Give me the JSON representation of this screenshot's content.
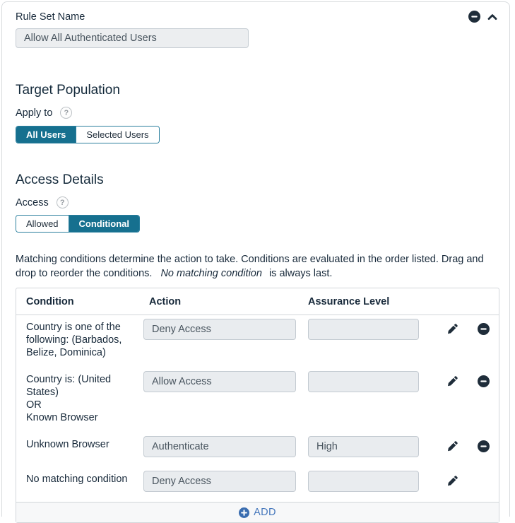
{
  "ui": {
    "help_glyph": "?"
  },
  "header": {
    "rule_set_label": "Rule Set Name",
    "rule_set_value": "Allow All Authenticated Users"
  },
  "target_population": {
    "heading": "Target Population",
    "apply_to_label": "Apply to",
    "options": [
      {
        "label": "All Users",
        "selected": true
      },
      {
        "label": "Selected Users",
        "selected": false
      }
    ]
  },
  "access_details": {
    "heading": "Access Details",
    "access_label": "Access",
    "options": [
      {
        "label": "Allowed",
        "selected": false
      },
      {
        "label": "Conditional",
        "selected": true
      }
    ]
  },
  "conditions_note": {
    "text_before": "Matching conditions determine the action to take. Conditions are evaluated in the order listed. Drag and drop to reorder the conditions.",
    "italic_text": "No matching condition",
    "text_after": "is always last."
  },
  "conditions_table": {
    "headers": [
      "Condition",
      "Action",
      "Assurance Level"
    ],
    "rows": [
      {
        "condition_lines": [
          "Country is one of the",
          "following: (Barbados,",
          "Belize, Dominica)"
        ],
        "action": "Deny Access",
        "assurance_level": "",
        "removable": true
      },
      {
        "condition_lines": [
          "Country is: (United States)",
          "OR",
          "Known Browser"
        ],
        "action": "Allow Access",
        "assurance_level": "",
        "removable": true
      },
      {
        "condition_lines": [
          "Unknown Browser"
        ],
        "action": "Authenticate",
        "assurance_level": "High",
        "removable": true
      },
      {
        "condition_lines": [
          "No matching condition"
        ],
        "action": "Deny Access",
        "assurance_level": "",
        "removable": false
      }
    ],
    "add_button_label": "ADD"
  },
  "colors": {
    "accent_teal": "#16708f",
    "icon_navy": "#1f2d3a",
    "add_blue": "#4577bc",
    "disabled_input_bg": "#e9ecef"
  }
}
